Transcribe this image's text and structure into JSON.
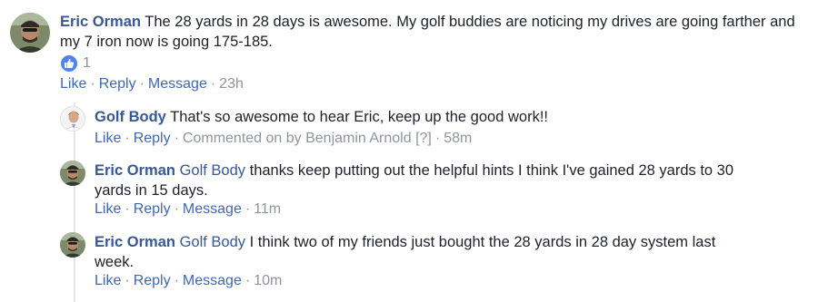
{
  "main_comment": {
    "author": "Eric Orman",
    "text": " The 28 yards in 28 days is awesome. My golf buddies are noticing my drives are going farther and my 7 iron now is going 175-185.",
    "reaction_count": "1",
    "like_label": "Like",
    "reply_label": "Reply",
    "message_label": "Message",
    "sep": "·",
    "time": "23h"
  },
  "replies": [
    {
      "author": "Golf Body",
      "text": " That's so awesome to hear Eric, keep up the good work!!",
      "like_label": "Like",
      "reply_label": "Reply",
      "sep": "·",
      "commented_by": "Commented on by Benjamin Arnold",
      "help": "[?]",
      "time": "58m"
    },
    {
      "author": "Eric Orman",
      "mention": "Golf Body",
      "text": " thanks keep putting out the helpful hints I think I've gained 28 yards to 30 yards in 15 days.",
      "like_label": "Like",
      "reply_label": "Reply",
      "message_label": "Message",
      "sep": "·",
      "time": "11m"
    },
    {
      "author": "Eric Orman",
      "mention": "Golf Body",
      "text": " I think two of my friends just bought the 28 yards in 28 day system last week.",
      "like_label": "Like",
      "reply_label": "Reply",
      "message_label": "Message",
      "sep": "·",
      "time": "10m"
    }
  ],
  "icons": {
    "like_reaction": "thumbs-up-icon",
    "eric_avatar": "avatar",
    "golfbody_avatar": "avatar"
  },
  "colors": {
    "link": "#385898",
    "action": "#4267b2",
    "muted": "#90949c",
    "like_badge": "#4d84f3"
  }
}
